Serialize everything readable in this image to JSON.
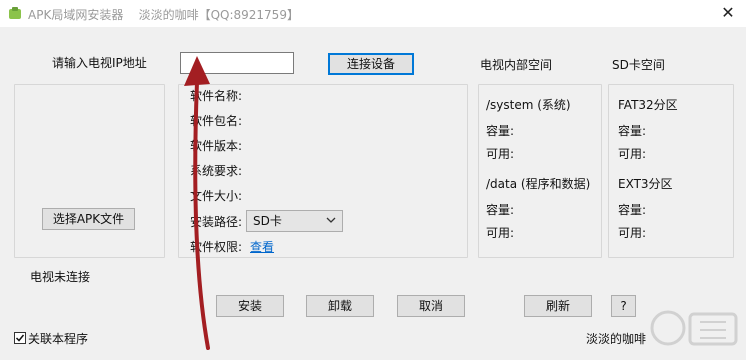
{
  "window": {
    "title": "APK局域网安装器    淡淡的咖啡【QQ:8921759】",
    "close_glyph": "✕"
  },
  "connect": {
    "ip_label": "请输入电视IP地址",
    "ip_value": "",
    "connect_button": "连接设备"
  },
  "left_panel": {
    "select_apk_button": "选择APK文件"
  },
  "info": {
    "name_label": "软件名称:",
    "package_label": "软件包名:",
    "version_label": "软件版本:",
    "system_req_label": "系统要求:",
    "file_size_label": "文件大小:",
    "install_path_label": "安装路径:",
    "install_path_value": "SD卡",
    "permissions_label": "软件权限:",
    "permissions_link": "查看"
  },
  "internal_storage": {
    "header": "电视内部空间",
    "system_label": "/system (系统)",
    "system_capacity": "容量:",
    "system_available": "可用:",
    "data_label": "/data (程序和数据)",
    "data_capacity": "容量:",
    "data_available": "可用:"
  },
  "sd_storage": {
    "header": "SD卡空间",
    "fat32_label": "FAT32分区",
    "fat32_capacity": "容量:",
    "fat32_available": "可用:",
    "ext3_label": "EXT3分区",
    "ext3_capacity": "容量:",
    "ext3_available": "可用:"
  },
  "status": {
    "connection_text": "电视未连接"
  },
  "actions": {
    "install": "安装",
    "uninstall": "卸载",
    "cancel": "取消",
    "refresh": "刷新",
    "help": "?"
  },
  "footer": {
    "associate_checkbox_label": "关联本程序",
    "associate_checked": true,
    "author": "淡淡的咖啡"
  },
  "colors": {
    "accent": "#0078d7",
    "link": "#0066cc",
    "annotation_arrow": "#a31e22"
  }
}
